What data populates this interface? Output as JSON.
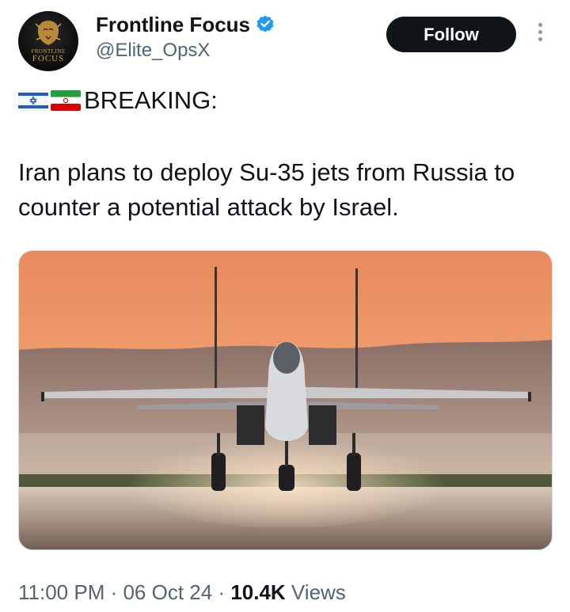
{
  "author": {
    "display_name": "Frontline Focus",
    "handle": "@Elite_OpsX",
    "verified": true,
    "avatar": {
      "icon": "lion-head-icon",
      "logo_line1": "FRONTLINE",
      "logo_line2": "FOCUS"
    }
  },
  "actions": {
    "follow_label": "Follow",
    "more_icon": "more-vertical-icon"
  },
  "tweet": {
    "flags": [
      "israel-flag-icon",
      "iran-flag-icon"
    ],
    "headline": "BREAKING:",
    "text": "Iran plans to deploy Su-35 jets from Russia to counter a potential attack by Israel.",
    "media_description": "Fighter jet on runway at sunset"
  },
  "meta": {
    "time": "11:00 PM",
    "separator1": " · ",
    "date": "06 Oct 24",
    "separator2": " · ",
    "views_count": "10.4K",
    "views_label": " Views"
  },
  "colors": {
    "text_primary": "#0f1419",
    "text_secondary": "#536471",
    "verified_blue": "#1d9bf0",
    "follow_bg": "#0f1419"
  }
}
